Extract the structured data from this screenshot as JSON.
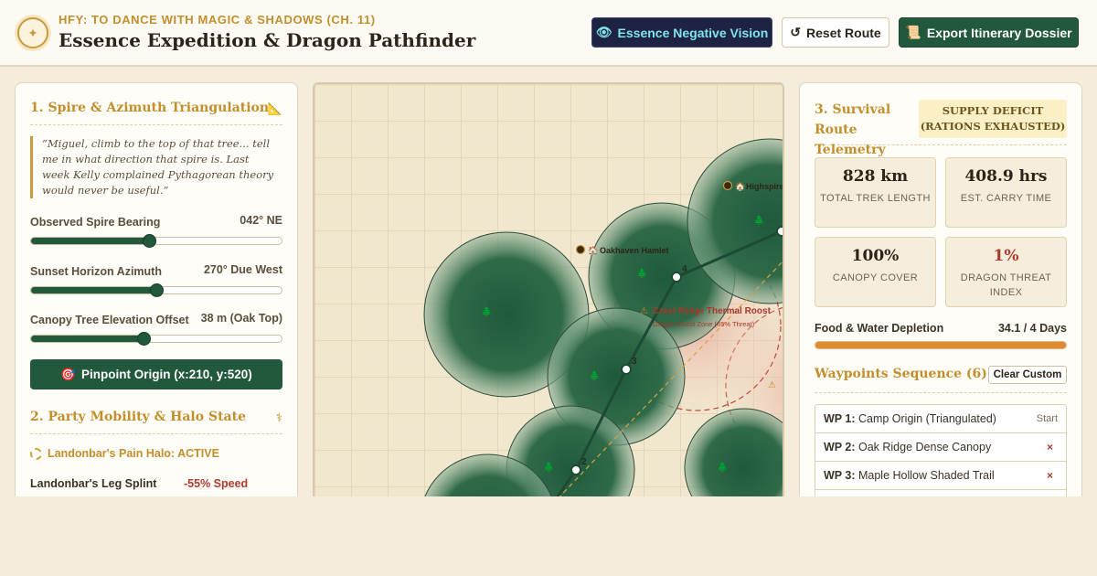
{
  "header": {
    "kicker": "HFY: TO DANCE WITH MAGIC & SHADOWS (CH. 11)",
    "title": "Essence Expedition & Dragon Pathfinder",
    "logo_icon": "compass-rose-icon",
    "buttons": {
      "vision": "Essence Negative Vision",
      "reset": "Reset Route",
      "export": "Export Itinerary Dossier"
    }
  },
  "left": {
    "section1_title": "1. Spire & Azimuth Triangulation",
    "quote": "“Miguel, climb to the top of that tree... tell me in what direction that spire is. Last week Kelly complained Pythagorean theory would never be useful.”",
    "sliders": [
      {
        "label": "Observed Spire Bearing",
        "value": "042° NE",
        "fraction": 0.47
      },
      {
        "label": "Sunset Horizon Azimuth",
        "value": "270° Due West",
        "fraction": 0.5
      },
      {
        "label": "Canopy Tree Elevation Offset",
        "value": "38 m (Oak Top)",
        "fraction": 0.45
      }
    ],
    "pinpoint_button": "Pinpoint Origin (x:210, y:520)",
    "section2_title": "2. Party Mobility & Halo State",
    "halo_status": "Landonbar's Pain Halo: ACTIVE",
    "splint_label": "Landonbar's Leg Splint",
    "splint_value": "-55% Speed"
  },
  "map": {
    "landmarks": {
      "highspire": "Highspire",
      "oakhaven": "Oakhaven Hamlet"
    },
    "hazard_title": "Crest Ridge Thermal Roost",
    "hazard_sub": "Dragon Roost Zone (85% Threat)",
    "waypoint_numbers": [
      "2",
      "3",
      "4"
    ]
  },
  "right": {
    "section_title": "3. Survival Route Telemetry",
    "deficit_line1": "SUPPLY DEFICIT",
    "deficit_line2": "(RATIONS EXHAUSTED)",
    "tiles": [
      {
        "value": "828 km",
        "label": "TOTAL TREK LENGTH"
      },
      {
        "value": "408.9 hrs",
        "label": "EST. CARRY TIME"
      },
      {
        "value": "100%",
        "label": "CANOPY COVER"
      },
      {
        "value": "1%",
        "label": "DRAGON THREAT INDEX"
      }
    ],
    "depletion_label": "Food & Water Depletion",
    "depletion_value": "34.1 / 4 Days",
    "depletion_fraction": 1.0,
    "waypoints_title": "Waypoints Sequence (6)",
    "clear_button": "Clear Custom",
    "waypoints": [
      {
        "id": "WP 1:",
        "name": "Camp Origin (Triangulated)",
        "tag": "Start"
      },
      {
        "id": "WP 2:",
        "name": "Oak Ridge Dense Canopy",
        "tag": "×"
      },
      {
        "id": "WP 3:",
        "name": "Maple Hollow Shaded Trail",
        "tag": "×"
      }
    ]
  },
  "colors": {
    "forest": "#22583b",
    "gold": "#c28f2c",
    "danger": "#b03a2e",
    "vision_bg": "#1d2340",
    "vision_text": "#7fe3f0"
  }
}
